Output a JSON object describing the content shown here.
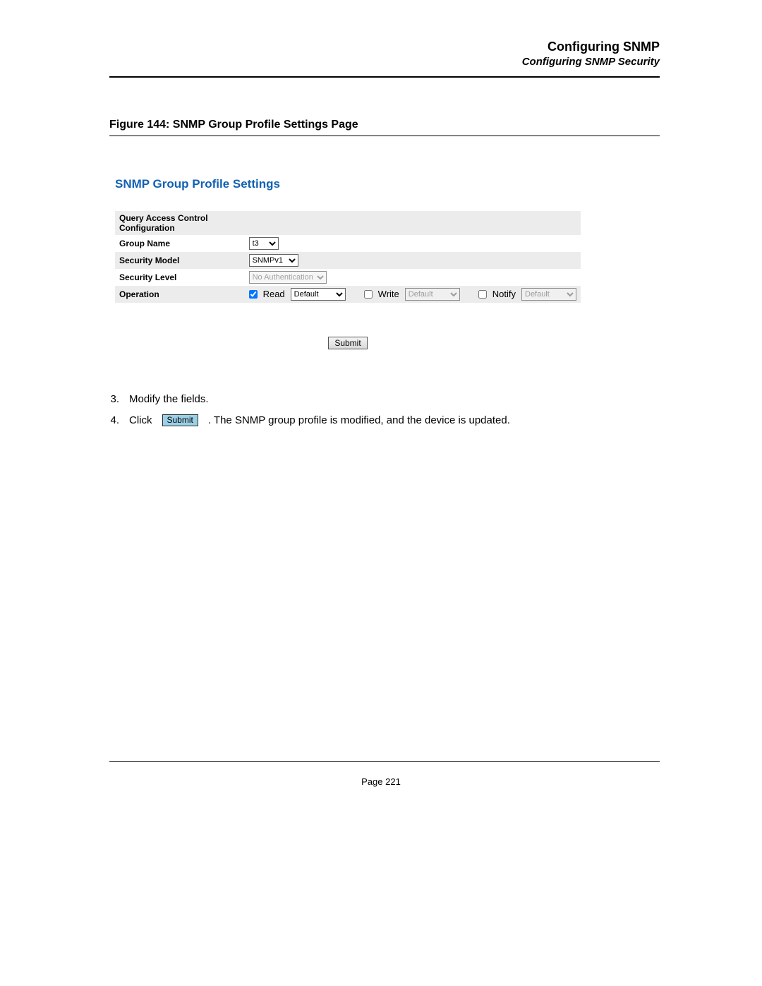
{
  "header": {
    "title": "Configuring SNMP",
    "subtitle": "Configuring SNMP Security"
  },
  "figure": {
    "caption": "Figure 144: SNMP Group Profile Settings Page"
  },
  "panel": {
    "title": "SNMP Group Profile Settings",
    "rows": {
      "query_header": "Query Access Control Configuration",
      "group_name_label": "Group Name",
      "group_name_value": "t3",
      "security_model_label": "Security Model",
      "security_model_value": "SNMPv1",
      "security_level_label": "Security Level",
      "security_level_value": "No Authentication",
      "operation_label": "Operation",
      "operation": {
        "read_label": "Read",
        "read_checked": true,
        "read_select": "Default",
        "write_label": "Write",
        "write_checked": false,
        "write_select": "Default",
        "notify_label": "Notify",
        "notify_checked": false,
        "notify_select": "Default"
      }
    },
    "submit_label": "Submit"
  },
  "steps": {
    "s3_num": "3.",
    "s3_text": "Modify the fields.",
    "s4_num": "4.",
    "s4_pre": "Click",
    "s4_btn": "Submit",
    "s4_post": ". The SNMP group profile is modified, and the device is updated."
  },
  "footer": {
    "page": "Page 221"
  }
}
